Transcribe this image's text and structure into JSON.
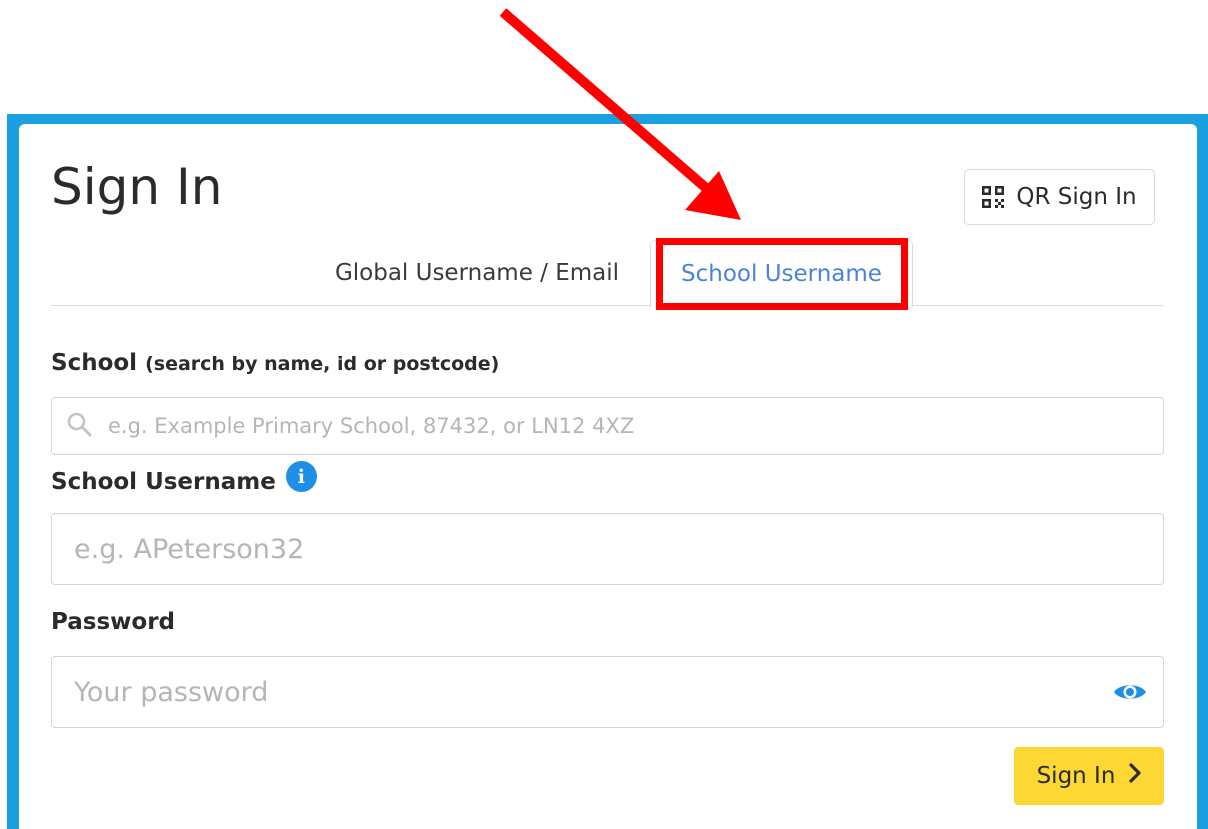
{
  "header": {
    "title": "Sign In",
    "qr_button_label": "QR Sign In"
  },
  "tabs": [
    {
      "label": "Global Username / Email",
      "active": false
    },
    {
      "label": "School Username",
      "active": true
    }
  ],
  "form": {
    "school": {
      "label": "School",
      "hint": "(search by name, id or postcode)",
      "placeholder": "e.g. Example Primary School, 87432, or LN12 4XZ",
      "value": ""
    },
    "username": {
      "label": "School Username",
      "info_icon": "i",
      "placeholder": "e.g. APeterson32",
      "value": ""
    },
    "password": {
      "label": "Password",
      "placeholder": "Your password",
      "value": ""
    },
    "submit_label": "Sign In"
  },
  "icons": {
    "qr": "qr-code-icon",
    "search": "search-icon",
    "info": "info-icon",
    "eye": "eye-icon",
    "chevron": "chevron-right-icon",
    "annotation_arrow": "red-arrow-icon"
  },
  "colors": {
    "frame": "#1aa0e0",
    "active_tab_text": "#4b83d6",
    "highlight": "#ff0000",
    "info": "#1f8fe5",
    "eye": "#1f8fe5",
    "submit_bg": "#fdd835"
  }
}
